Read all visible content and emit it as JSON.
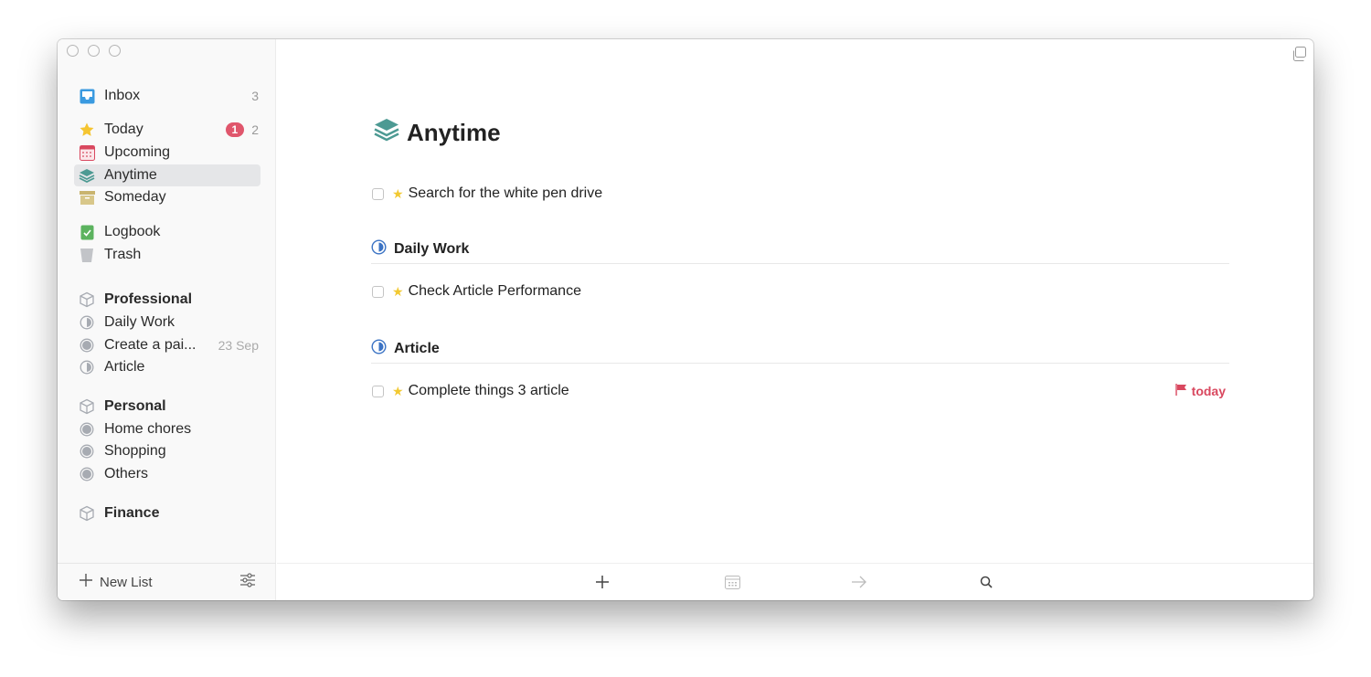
{
  "sidebar": {
    "inbox": {
      "label": "Inbox",
      "count": "3"
    },
    "today": {
      "label": "Today",
      "badge": "1",
      "count": "2"
    },
    "upcoming": {
      "label": "Upcoming"
    },
    "anytime": {
      "label": "Anytime"
    },
    "someday": {
      "label": "Someday"
    },
    "logbook": {
      "label": "Logbook"
    },
    "trash": {
      "label": "Trash"
    },
    "areas": [
      {
        "label": "Professional",
        "projects": [
          {
            "label": "Daily Work",
            "icon": "half-circle"
          },
          {
            "label": "Create a pai...",
            "date": "23 Sep",
            "icon": "full-circle"
          },
          {
            "label": "Article",
            "icon": "half-circle"
          }
        ]
      },
      {
        "label": "Personal",
        "projects": [
          {
            "label": "Home chores",
            "icon": "full-circle"
          },
          {
            "label": "Shopping",
            "icon": "full-circle"
          },
          {
            "label": "Others",
            "icon": "full-circle"
          }
        ]
      },
      {
        "label": "Finance",
        "projects": []
      }
    ],
    "new_list": "New List"
  },
  "main": {
    "title": "Anytime",
    "tasks": [
      {
        "text": "Search for the white pen drive",
        "starred": true
      }
    ],
    "sections": [
      {
        "title": "Daily Work",
        "tasks": [
          {
            "text": "Check Article Performance",
            "starred": true
          }
        ]
      },
      {
        "title": "Article",
        "tasks": [
          {
            "text": "Complete things 3 article",
            "starred": true,
            "due": "today"
          }
        ]
      }
    ]
  },
  "colors": {
    "accent_blue": "#3b73c4",
    "badge_red": "#e0566c",
    "anytime_teal": "#4d9a93",
    "star": "#f2c932"
  }
}
